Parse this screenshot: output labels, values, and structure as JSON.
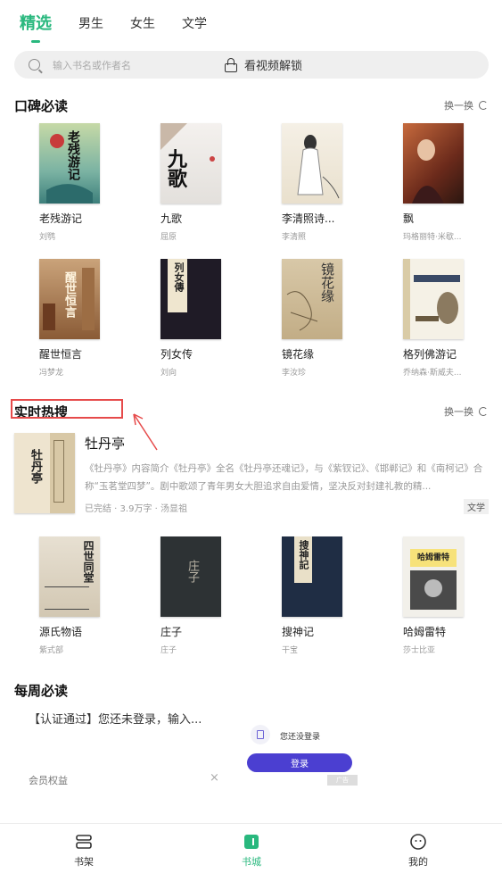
{
  "tabs": [
    {
      "label": "精选",
      "active": true
    },
    {
      "label": "男生",
      "active": false
    },
    {
      "label": "女生",
      "active": false
    },
    {
      "label": "文学",
      "active": false
    }
  ],
  "search": {
    "placeholder": "输入书名或作者名",
    "unlock_label": "看视频解锁"
  },
  "section1": {
    "title": "口碑必读",
    "refresh": "换一换",
    "books": [
      {
        "title": "老残游记",
        "author": "刘鹗"
      },
      {
        "title": "九歌",
        "author": "屈原"
      },
      {
        "title": "李清照诗...",
        "author": "李清照"
      },
      {
        "title": "飘",
        "author": "玛格丽特·米歇..."
      },
      {
        "title": "醒世恒言",
        "author": "冯梦龙"
      },
      {
        "title": "列女传",
        "author": "刘向"
      },
      {
        "title": "镜花缘",
        "author": "李汝珍"
      },
      {
        "title": "格列佛游记",
        "author": "乔纳森·斯威夫..."
      }
    ]
  },
  "section2": {
    "title": "实时热搜",
    "refresh": "换一换",
    "featured": {
      "title": "牡丹亭",
      "desc": "《牡丹亭》内容简介《牡丹亭》全名《牡丹亭还魂记》，与《紫钗记》、《邯郸记》和《南柯记》合称“玉茗堂四梦”。剧中歌颂了青年男女大胆追求自由爱情，坚决反对封建礼教的精...",
      "meta": "已完结 · 3.9万字 · 汤显祖",
      "tag": "文学"
    },
    "books": [
      {
        "title": "源氏物语",
        "author": "紫式部"
      },
      {
        "title": "庄子",
        "author": "庄子"
      },
      {
        "title": "搜神记",
        "author": "干宝"
      },
      {
        "title": "哈姆雷特",
        "author": "莎士比亚"
      }
    ]
  },
  "section3": {
    "title": "每周必读"
  },
  "ad": {
    "text": "【认证通过】您还未登录，输入...",
    "login_hint": "您还没登录",
    "button": "登录",
    "vip": "会员权益",
    "close": "×",
    "badge": "广告"
  },
  "nav": [
    {
      "label": "书架",
      "icon": "bookshelf-icon"
    },
    {
      "label": "书城",
      "icon": "bookstore-icon",
      "active": true
    },
    {
      "label": "我的",
      "icon": "profile-icon"
    }
  ],
  "colors": {
    "accent": "#29b87e",
    "highlight": "#e64a4a",
    "ad_button": "#4b3fd1"
  }
}
